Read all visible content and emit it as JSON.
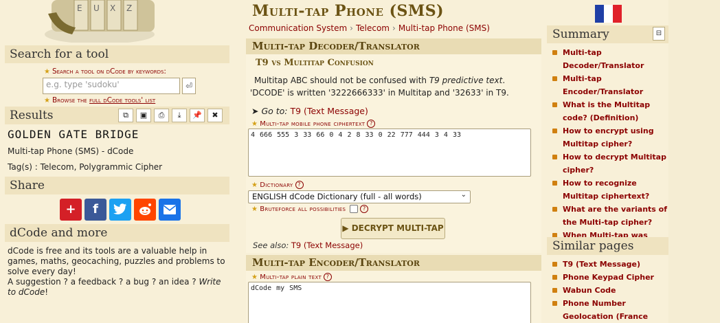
{
  "left": {
    "search_title": "Search for a tool",
    "search_label": "Search a tool on dCode by keywords:",
    "search_placeholder": "e.g. type 'sudoku'",
    "browse_prefix": "Browse the ",
    "browse_link": "full dCode tools' list",
    "results_title": "Results",
    "result_value": "GOLDEN GATE BRIDGE",
    "result_tool": "Multi-tap Phone (SMS) - ",
    "result_tool_link": "dCode",
    "result_tags": "Tag(s) : Telecom, Polygrammic Cipher",
    "share_title": "Share",
    "more_title": "dCode and more",
    "more_text1": "dCode is free and its tools are a valuable help in games, maths, geocaching, puzzles and problems to solve every day!",
    "more_text2": "A suggestion ? a feedback ? a bug ? an idea ? ",
    "more_link": "Write to dCode",
    "more_end": "!"
  },
  "main": {
    "title": "Multi-tap Phone (SMS)",
    "breadcrumbs": [
      "Communication System",
      "Telecom",
      "Multi-tap Phone (SMS)"
    ],
    "decoder_title": "Multi-tap Decoder/Translator",
    "confusion_title": "T9 vs Multitap Confusion",
    "confusion_text_a": "Multitap ABC should not be confused with ",
    "confusion_text_i": "T9 predictive text",
    "confusion_text_b": ". 'DCODE' is written '3222666333' in Multitap and '32633' in T9.",
    "goto_prefix": "Go to: ",
    "goto_link": "T9 (Text Message)",
    "cipher_label": "Multi-tap mobile phone ciphertext",
    "cipher_value": "4 666 555 3 33 66 0 4 2 8 33 0 22 777 444 3 4 33",
    "dict_label": "Dictionary",
    "dict_value": "ENGLISH dCode Dictionary (full - all words)",
    "brute_label": "Bruteforce all possibilities",
    "decrypt_button": "DECRYPT MULTI-TAP",
    "seealso_prefix": "See also: ",
    "seealso_link": "T9 (Text Message)",
    "encoder_title": "Multi-tap Encoder/Translator",
    "plain_label": "Multi-tap plain text",
    "plain_value": "dCode my SMS"
  },
  "right": {
    "summary_title": "Summary",
    "summary_items": [
      "Multi-tap Decoder/Translator",
      "Multi-tap Encoder/Translator",
      "What is the Multitap code? (Definition)",
      "How to encrypt using Multitap cipher?",
      "How to decrypt Multitap cipher?",
      "How to recognize Multitap ciphertext?",
      "What are the variants of the Multi-tap cipher?",
      "When Multi-tap was invented?"
    ],
    "similar_title": "Similar pages",
    "similar_items": [
      "T9 (Text Message)",
      "Phone Keypad Cipher",
      "Wabun Code",
      "Phone Number Geolocation (France Only)"
    ]
  },
  "colors": {
    "link": "#8b0000",
    "title": "#6b5314",
    "panel": "#e9dcb4",
    "bullet": "#d08010"
  }
}
